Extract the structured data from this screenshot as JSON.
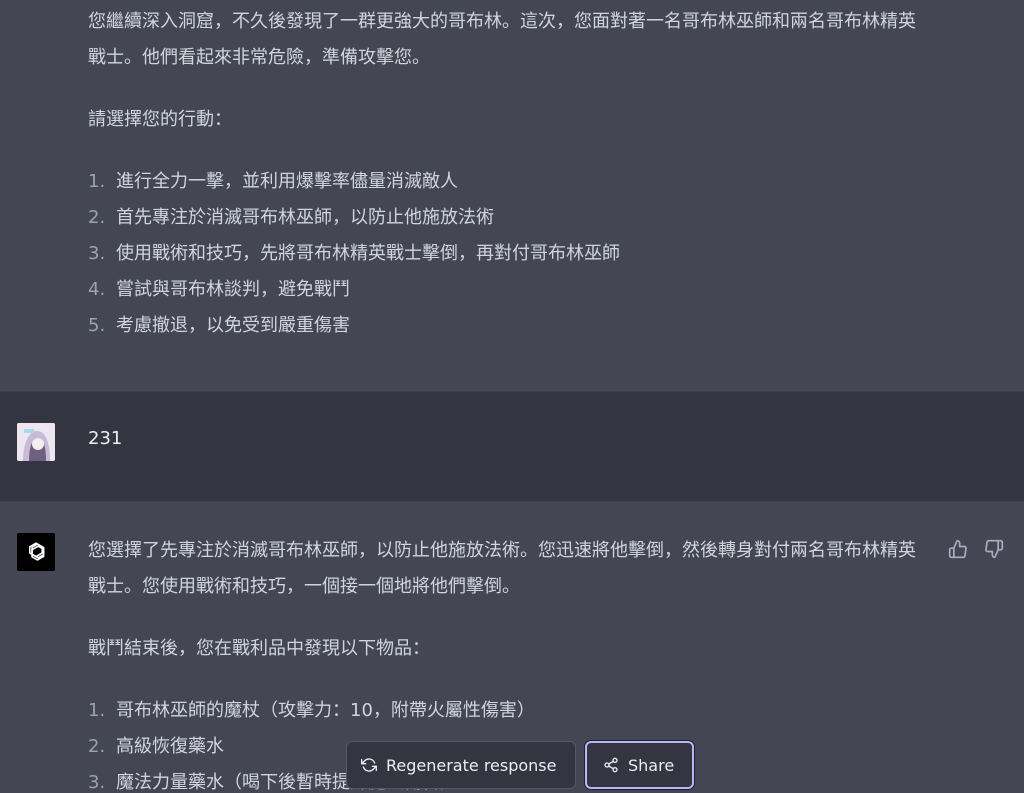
{
  "previous_reply": {
    "intro": "您繼續深入洞窟，不久後發現了一群更強大的哥布林。這次，您面對著一名哥布林巫師和兩名哥布林精英戰士。他們看起來非常危險，準備攻擊您。",
    "prompt": "請選擇您的行動：",
    "options": [
      {
        "num": "1.",
        "text": "進行全力一擊，並利用爆擊率儘量消滅敵人"
      },
      {
        "num": "2.",
        "text": "首先專注於消滅哥布林巫師，以防止他施放法術"
      },
      {
        "num": "3.",
        "text": "使用戰術和技巧，先將哥布林精英戰士擊倒，再對付哥布林巫師"
      },
      {
        "num": "4.",
        "text": "嘗試與哥布林談判，避免戰鬥"
      },
      {
        "num": "5.",
        "text": "考慮撤退，以免受到嚴重傷害"
      }
    ]
  },
  "user_message": {
    "text": "231"
  },
  "current_reply": {
    "intro": "您選擇了先專注於消滅哥布林巫師，以防止他施放法術。您迅速將他擊倒，然後轉身對付兩名哥布林精英戰士。您使用戰術和技巧，一個接一個地將他們擊倒。",
    "loot_intro": "戰鬥結束後，您在戰利品中發現以下物品：",
    "items": [
      {
        "num": "1.",
        "text": "哥布林巫師的魔杖（攻擊力：10，附帶火屬性傷害）"
      },
      {
        "num": "2.",
        "text": "高級恢復藥水"
      },
      {
        "num": "3.",
        "text": "魔法力量藥水（喝下後暫時提升魔法傷害）"
      }
    ]
  },
  "actions": {
    "regenerate_label": "Regenerate response",
    "share_label": "Share"
  },
  "icons": {
    "thumbs_up": "thumbs-up-icon",
    "thumbs_down": "thumbs-down-icon",
    "regenerate": "refresh-icon",
    "share": "share-icon",
    "bot_avatar": "openai-logo-icon"
  },
  "colors": {
    "assistant_bg": "#444654",
    "user_bg": "#343541",
    "text": "#d1d5db",
    "share_border": "#b4b8f5"
  }
}
